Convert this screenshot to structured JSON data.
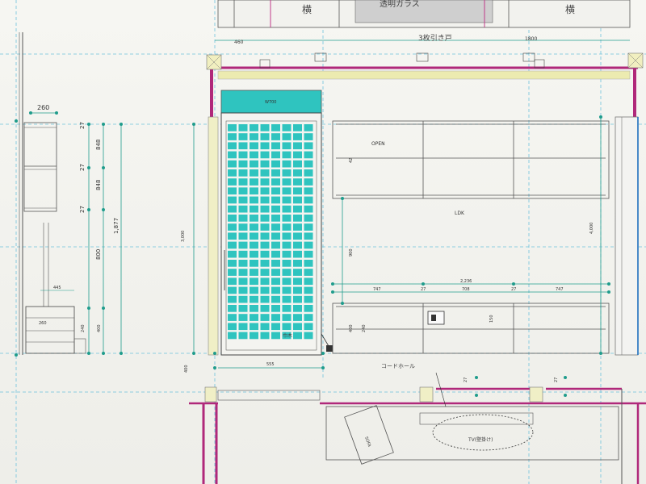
{
  "title": "3枚引き戸",
  "labels": {
    "open": "OPEN",
    "ldk": "LDK",
    "cord_reel": "コードホール",
    "tv": "TV(壁掛け)",
    "glass": "透明ガラス",
    "yoko_left": "横",
    "yoko_right": "横",
    "door_label": "W700",
    "floor_note": "巾木"
  },
  "dims": {
    "top_w": "460",
    "top_right": "1800",
    "shelf_w": "260",
    "v_27a": "27",
    "v_848a": "848",
    "v_27b": "27",
    "v_848b": "848",
    "v_27c": "27",
    "v_800": "800",
    "v_1877": "1,877",
    "v_240": "240",
    "v_400": "400",
    "v_3000": "3,000",
    "v_900": "900",
    "v_4000": "4,000",
    "h_2236": "2,236",
    "h_747a": "747",
    "h_27a": "27",
    "h_708": "708",
    "h_27b": "27",
    "h_747b": "747",
    "bottom_555": "555",
    "sm_260": "260",
    "sm_445": "445",
    "left_400": "400",
    "v_42": "42",
    "v_27d": "27",
    "v_27e": "27",
    "cab_240": "240",
    "cab_400": "400",
    "cab_150": "150"
  },
  "colors": {
    "wall_magenta": "#b0287a",
    "wall_yellow": "#e8e6a0",
    "glass_cyan": "#2fc4bf",
    "dim_teal": "#1f9c8c",
    "guide_cyan": "#5ab8d8"
  }
}
